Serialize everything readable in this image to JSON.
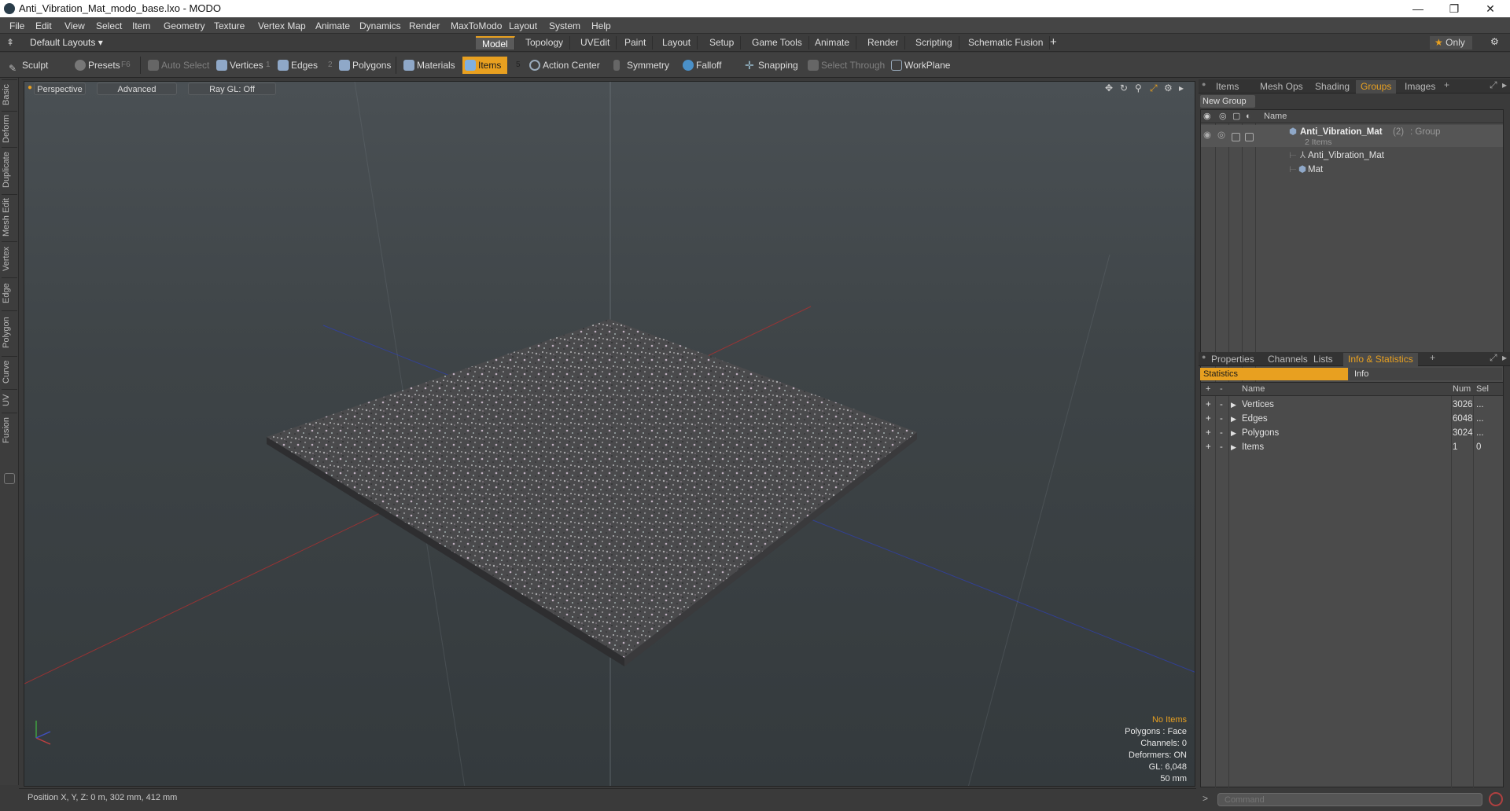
{
  "window": {
    "title": "Anti_Vibration_Mat_modo_base.lxo - MODO",
    "minimize": "—",
    "maximize": "❐",
    "close": "✕"
  },
  "menu": [
    "File",
    "Edit",
    "View",
    "Select",
    "Item",
    "Geometry",
    "Texture",
    "Vertex Map",
    "Animate",
    "Dynamics",
    "Render",
    "MaxToModo",
    "Layout",
    "System",
    "Help"
  ],
  "layout": {
    "dropdown": "Default Layouts",
    "tabs": [
      "Model",
      "Topology",
      "UVEdit",
      "Paint",
      "Layout",
      "Setup",
      "Game Tools",
      "Animate",
      "Render",
      "Scripting",
      "Schematic Fusion"
    ],
    "active_tab": "Model",
    "add": "+",
    "only": "Only"
  },
  "toolbar": {
    "sculpt": "Sculpt",
    "presets": "Presets",
    "presets_key": "F6",
    "auto_select": "Auto Select",
    "vertices": "Vertices",
    "vertices_key": "1",
    "edges": "Edges",
    "edges_key": "2",
    "polygons": "Polygons",
    "materials": "Materials",
    "items": "Items",
    "items_key": "5",
    "action_center": "Action Center",
    "symmetry": "Symmetry",
    "falloff": "Falloff",
    "snapping": "Snapping",
    "select_through": "Select Through",
    "workplane": "WorkPlane"
  },
  "side_tabs": [
    "Basic",
    "Deform",
    "Duplicate",
    "Mesh Edit",
    "Vertex",
    "Edge",
    "Polygon",
    "Curve",
    "UV",
    "Fusion"
  ],
  "viewport": {
    "perspective": "Perspective",
    "advanced": "Advanced",
    "raygl": "Ray GL: Off",
    "hud": {
      "no_items": "No Items",
      "polygons": "Polygons : Face",
      "channels": "Channels: 0",
      "deformers": "Deformers: ON",
      "gl": "GL: 6,048",
      "scale": "50 mm"
    }
  },
  "status": {
    "position": "Position X, Y, Z:  0 m, 302 mm, 412 mm"
  },
  "groups_panel": {
    "tabs": [
      "Items",
      "Mesh Ops",
      "Shading",
      "Groups",
      "Images"
    ],
    "active_tab": "Groups",
    "new_group": "New Group",
    "name_header": "Name",
    "group_name": "Anti_Vibration_Mat",
    "group_count": "(2)",
    "group_type": ": Group",
    "group_sub": "2 Items",
    "children": [
      "Anti_Vibration_Mat",
      "Mat"
    ]
  },
  "stats_panel": {
    "tabs": [
      "Properties",
      "Channels",
      "Lists",
      "Info & Statistics"
    ],
    "active_tab": "Info & Statistics",
    "subtabs": [
      "Statistics",
      "Info"
    ],
    "headers": {
      "name": "Name",
      "num": "Num",
      "sel": "Sel"
    },
    "rows": [
      {
        "name": "Vertices",
        "num": "3026",
        "sel": "..."
      },
      {
        "name": "Edges",
        "num": "6048",
        "sel": "..."
      },
      {
        "name": "Polygons",
        "num": "3024",
        "sel": "..."
      },
      {
        "name": "Items",
        "num": "1",
        "sel": "0"
      }
    ]
  },
  "command": {
    "placeholder": "Command"
  }
}
